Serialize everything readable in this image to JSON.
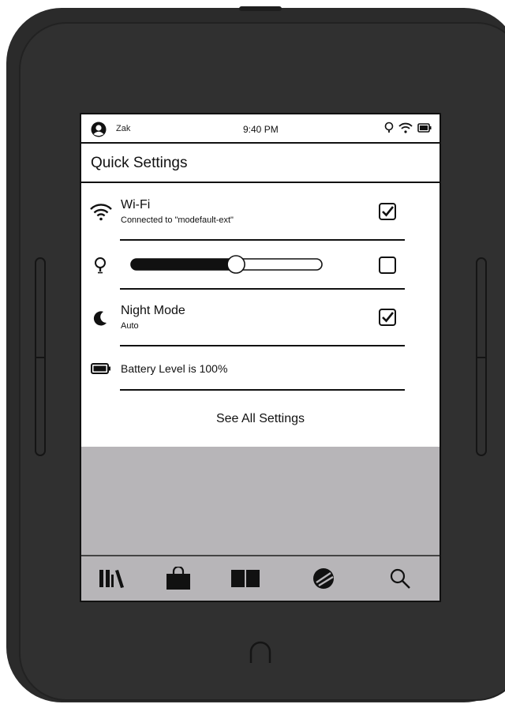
{
  "status": {
    "user": "Zak",
    "time": "9:40 PM"
  },
  "quick_settings": {
    "title": "Quick Settings",
    "wifi": {
      "title": "Wi-Fi",
      "subtitle": "Connected to \"modefault-ext\"",
      "checked": true
    },
    "brightness": {
      "level": 0.55,
      "checked": false
    },
    "night_mode": {
      "title": "Night Mode",
      "subtitle": "Auto",
      "checked": true
    },
    "battery": {
      "text": "Battery Level is 100%"
    },
    "see_all": "See All Settings"
  },
  "nav": {
    "items": [
      {
        "icon": "library-icon"
      },
      {
        "icon": "shop-bag-icon"
      },
      {
        "icon": "open-book-icon"
      },
      {
        "icon": "discover-globe-icon"
      },
      {
        "icon": "search-icon"
      }
    ]
  },
  "colors": {
    "device": "#2b2b2b",
    "screen": "#ffffff",
    "grey_area": "#b7b5b8",
    "ink": "#111111"
  }
}
